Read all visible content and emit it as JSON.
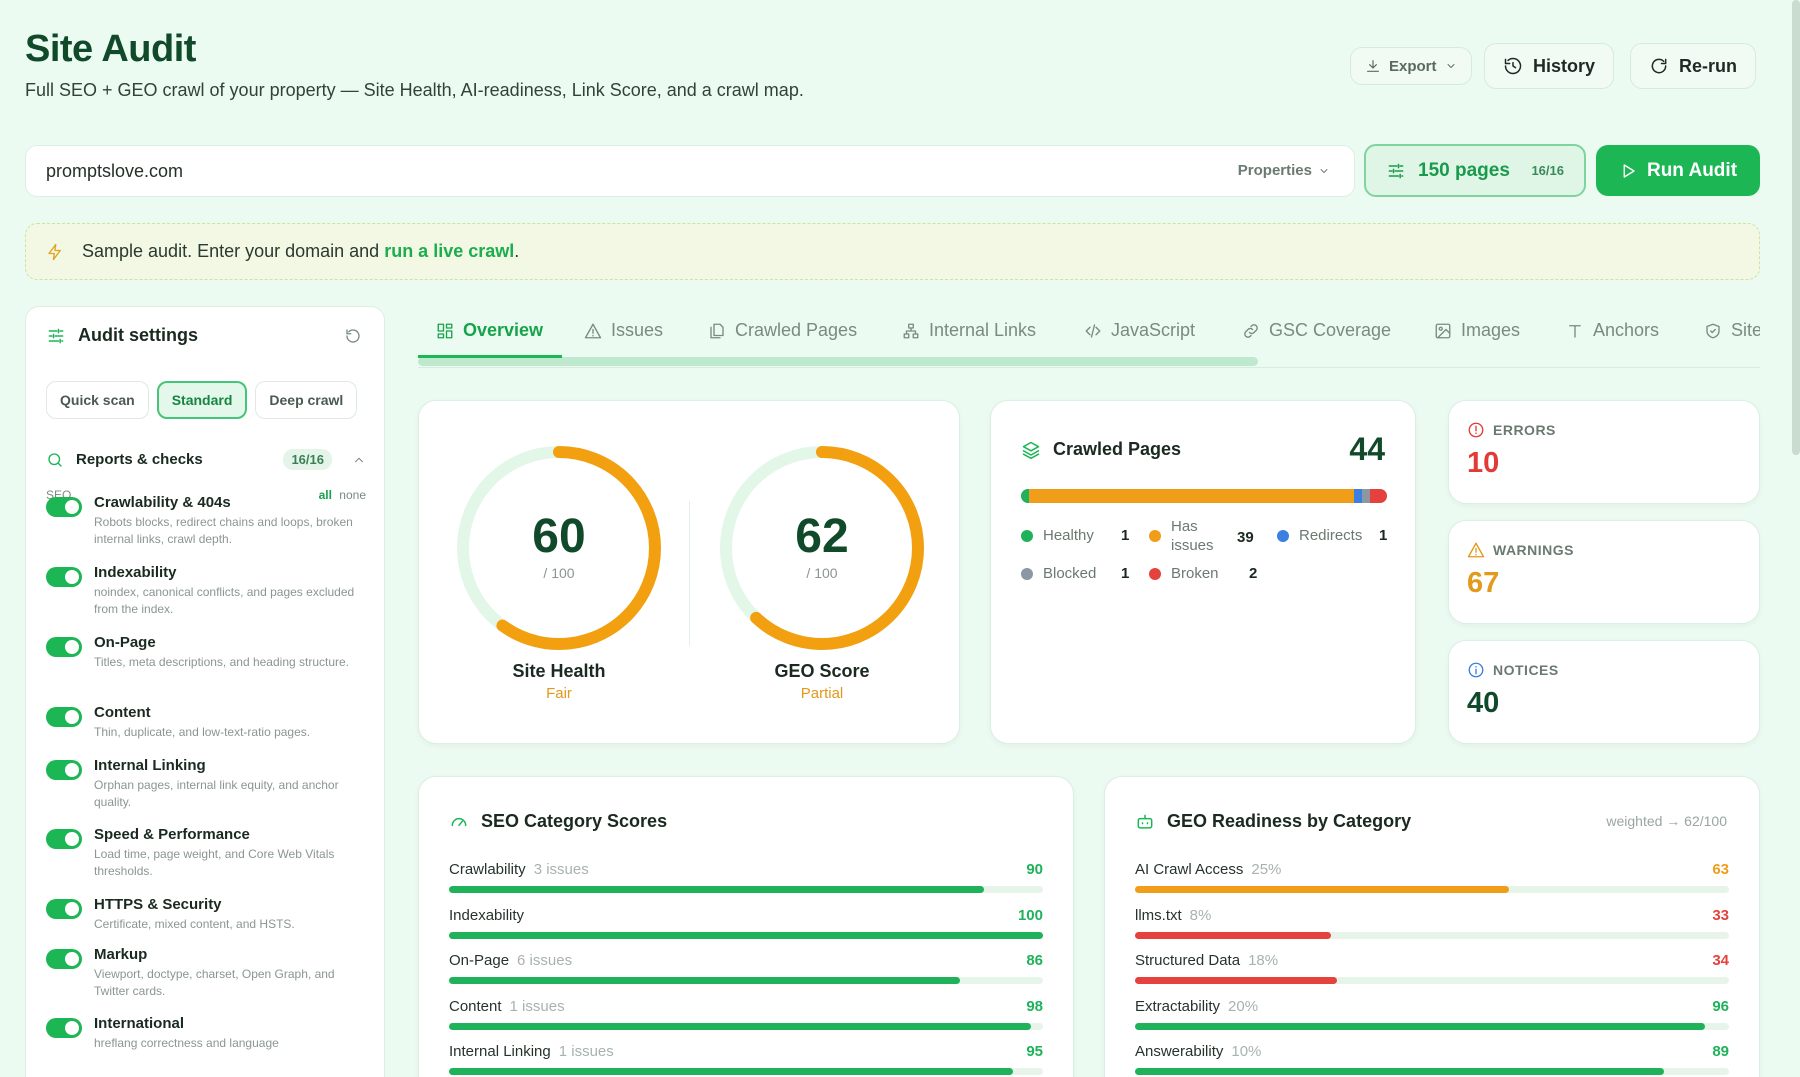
{
  "header": {
    "title": "Site Audit",
    "subtitle": "Full SEO + GEO crawl of your property — Site Health, AI-readiness, Link Score, and a crawl map.",
    "export_label": "Export",
    "history_label": "History",
    "rerun_label": "Re-run"
  },
  "search": {
    "url_value": "promptslove.com",
    "properties_label": "Properties",
    "pages_label": "150 pages",
    "pages_count": "16/16",
    "run_label": "Run Audit"
  },
  "notice": {
    "text": "Sample audit. Enter your domain and ",
    "link": "run a live crawl",
    "end": "."
  },
  "sidebar": {
    "title": "Audit settings",
    "modes": [
      "Quick scan",
      "Standard",
      "Deep crawl"
    ],
    "active_mode": "Standard",
    "reports_label": "Reports & checks",
    "reports_count": "16/16",
    "section": "SEO",
    "all_label": "all",
    "none_label": "none",
    "checks": [
      {
        "name": "Crawlability & 404s",
        "desc": "Robots blocks, redirect chains and loops, broken internal links, crawl depth.",
        "enabled": true
      },
      {
        "name": "Indexability",
        "desc": "noindex, canonical conflicts, and pages excluded from the index.",
        "enabled": true
      },
      {
        "name": "On-Page",
        "desc": "Titles, meta descriptions, and heading structure.",
        "enabled": true
      },
      {
        "name": "Content",
        "desc": "Thin, duplicate, and low-text-ratio pages.",
        "enabled": true
      },
      {
        "name": "Internal Linking",
        "desc": "Orphan pages, internal link equity, and anchor quality.",
        "enabled": true
      },
      {
        "name": "Speed & Performance",
        "desc": "Load time, page weight, and Core Web Vitals thresholds.",
        "enabled": true
      },
      {
        "name": "HTTPS & Security",
        "desc": "Certificate, mixed content, and HSTS.",
        "enabled": true
      },
      {
        "name": "Markup",
        "desc": "Viewport, doctype, charset, Open Graph, and Twitter cards.",
        "enabled": true
      },
      {
        "name": "International",
        "desc": "hreflang correctness and language",
        "enabled": true
      }
    ]
  },
  "tabs": [
    "Overview",
    "Issues",
    "Crawled Pages",
    "Internal Links",
    "JavaScript",
    "GSC Coverage",
    "Images",
    "Anchors",
    "Site"
  ],
  "active_tab": "Overview",
  "gauges": [
    {
      "value": "60",
      "denominator": "/ 100",
      "label": "Site Health",
      "status": "Fair",
      "fraction": 0.6
    },
    {
      "value": "62",
      "denominator": "/ 100",
      "label": "GEO Score",
      "status": "Partial",
      "fraction": 0.62
    }
  ],
  "crawled": {
    "title": "Crawled Pages",
    "total": "44",
    "legend": [
      {
        "label": "Healthy",
        "value": "1",
        "color": "#1fb25a"
      },
      {
        "label": "Has issues",
        "value": "39",
        "color": "#f09d1a"
      },
      {
        "label": "Redirects",
        "value": "1",
        "color": "#3b7fe0"
      },
      {
        "label": "Blocked",
        "value": "1",
        "color": "#8b97a3"
      },
      {
        "label": "Broken",
        "value": "2",
        "color": "#e5413d"
      }
    ]
  },
  "stats": [
    {
      "label": "ERRORS",
      "value": "10",
      "color": "#e23a36"
    },
    {
      "label": "WARNINGS",
      "value": "67",
      "color": "#e3991b"
    },
    {
      "label": "NOTICES",
      "value": "40",
      "color": "#114a2b"
    }
  ],
  "seo_scores": {
    "title": "SEO Category Scores",
    "rows": [
      {
        "label": "Crawlability",
        "sub": "3 issues",
        "value": "90",
        "score": 90
      },
      {
        "label": "Indexability",
        "sub": "",
        "value": "100",
        "score": 100
      },
      {
        "label": "On-Page",
        "sub": "6 issues",
        "value": "86",
        "score": 86
      },
      {
        "label": "Content",
        "sub": "1 issues",
        "value": "98",
        "score": 98
      },
      {
        "label": "Internal Linking",
        "sub": "1 issues",
        "value": "95",
        "score": 95
      }
    ]
  },
  "geo_scores": {
    "title": "GEO Readiness by Category",
    "note": "weighted → 62/100",
    "rows": [
      {
        "label": "AI Crawl Access",
        "sub": "25%",
        "value": "63",
        "score": 63,
        "color": "#f09d1a"
      },
      {
        "label": "llms.txt",
        "sub": "8%",
        "value": "33",
        "score": 33,
        "color": "#e5413d"
      },
      {
        "label": "Structured Data",
        "sub": "18%",
        "value": "34",
        "score": 34,
        "color": "#e5413d"
      },
      {
        "label": "Extractability",
        "sub": "20%",
        "value": "96",
        "score": 96,
        "color": "#1fb25a"
      },
      {
        "label": "Answerability",
        "sub": "10%",
        "value": "89",
        "score": 89,
        "color": "#1fb25a"
      }
    ]
  },
  "colors": {
    "brand": "#1cb655",
    "ok": "#1fb25a",
    "warn": "#f09d1a",
    "bad": "#e5413d"
  }
}
